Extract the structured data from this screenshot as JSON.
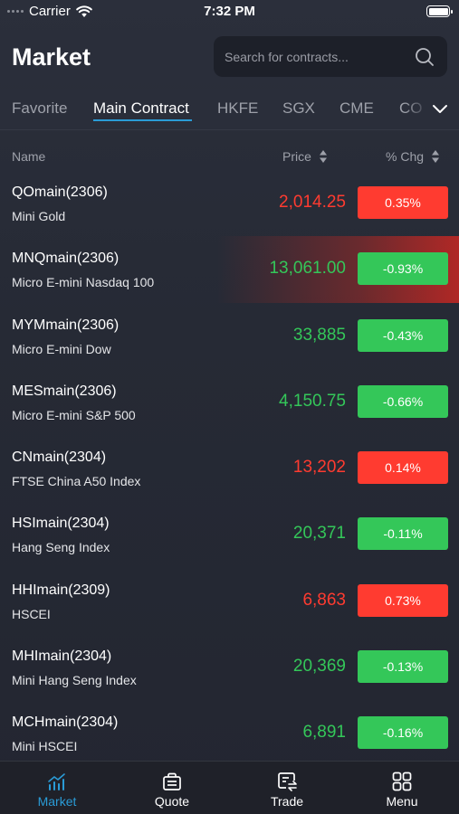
{
  "status_bar": {
    "carrier": "Carrier",
    "time": "7:32 PM"
  },
  "header": {
    "title": "Market",
    "search_placeholder": "Search for contracts..."
  },
  "tabs": [
    {
      "label": "Favorite",
      "active": false
    },
    {
      "label": "Main Contract",
      "active": true
    },
    {
      "label": "HKFE",
      "active": false
    },
    {
      "label": "SGX",
      "active": false
    },
    {
      "label": "CME",
      "active": false
    },
    {
      "label": "CO",
      "active": false
    }
  ],
  "columns": {
    "name": "Name",
    "price": "Price",
    "chg": "% Chg"
  },
  "rows": [
    {
      "symbol": "QOmain(2306)",
      "desc": "Mini Gold",
      "price": "2,014.25",
      "chg": "0.35%",
      "dir": "up"
    },
    {
      "symbol": "MNQmain(2306)",
      "desc": "Micro  E-mini Nasdaq 100",
      "price": "13,061.00",
      "chg": "-0.93%",
      "dir": "down",
      "flash": true
    },
    {
      "symbol": "MYMmain(2306)",
      "desc": "Micro E-mini Dow",
      "price": "33,885",
      "chg": "-0.43%",
      "dir": "down"
    },
    {
      "symbol": "MESmain(2306)",
      "desc": "Micro E-mini S&P 500",
      "price": "4,150.75",
      "chg": "-0.66%",
      "dir": "down"
    },
    {
      "symbol": "CNmain(2304)",
      "desc": "FTSE China A50 Index",
      "price": "13,202",
      "chg": "0.14%",
      "dir": "up"
    },
    {
      "symbol": "HSImain(2304)",
      "desc": "Hang Seng Index",
      "price": "20,371",
      "chg": "-0.11%",
      "dir": "down"
    },
    {
      "symbol": "HHImain(2309)",
      "desc": "HSCEI",
      "price": "6,863",
      "chg": "0.73%",
      "dir": "up"
    },
    {
      "symbol": "MHImain(2304)",
      "desc": "Mini Hang Seng Index",
      "price": "20,369",
      "chg": "-0.13%",
      "dir": "down"
    },
    {
      "symbol": "MCHmain(2304)",
      "desc": "Mini HSCEI",
      "price": "6,891",
      "chg": "-0.16%",
      "dir": "down"
    }
  ],
  "tab_bar": [
    {
      "label": "Market",
      "icon": "market-chart-icon",
      "active": true
    },
    {
      "label": "Quote",
      "icon": "quote-briefcase-icon",
      "active": false
    },
    {
      "label": "Trade",
      "icon": "trade-exchange-icon",
      "active": false
    },
    {
      "label": "Menu",
      "icon": "menu-grid-icon",
      "active": false
    }
  ],
  "colors": {
    "accent": "#2a9bd6",
    "up": "#ff3b30",
    "down": "#34c759",
    "background": "#2a2e3a"
  }
}
